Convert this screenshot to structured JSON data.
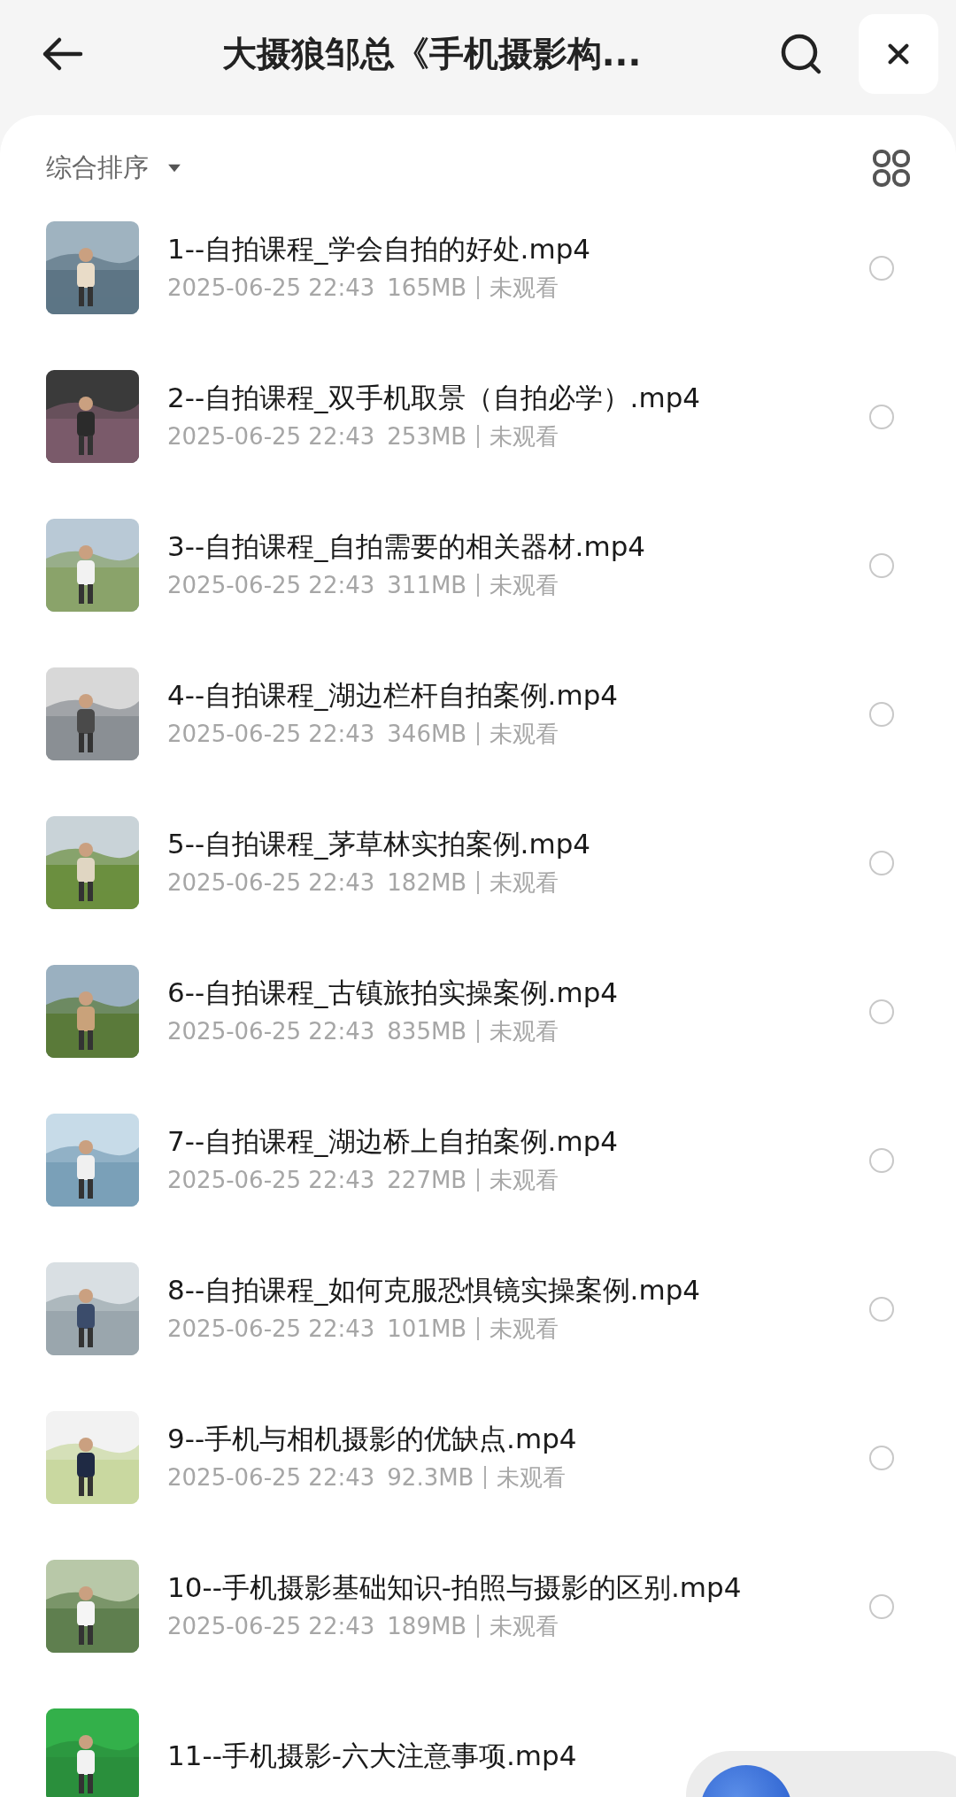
{
  "header": {
    "title": "大摄狼邹总《手机摄影构..."
  },
  "sort": {
    "label": "综合排序"
  },
  "files": [
    {
      "name": "1--自拍课程_学会自拍的好处.mp4",
      "date": "2025-06-25 22:43",
      "size": "165MB",
      "status": "未观看",
      "selected": false
    },
    {
      "name": "2--自拍课程_双手机取景（自拍必学）.mp4",
      "date": "2025-06-25 22:43",
      "size": "253MB",
      "status": "未观看",
      "selected": false
    },
    {
      "name": "3--自拍课程_自拍需要的相关器材.mp4",
      "date": "2025-06-25 22:43",
      "size": "311MB",
      "status": "未观看",
      "selected": false
    },
    {
      "name": "4--自拍课程_湖边栏杆自拍案例.mp4",
      "date": "2025-06-25 22:43",
      "size": "346MB",
      "status": "未观看",
      "selected": false
    },
    {
      "name": "5--自拍课程_茅草林实拍案例.mp4",
      "date": "2025-06-25 22:43",
      "size": "182MB",
      "status": "未观看",
      "selected": false
    },
    {
      "name": "6--自拍课程_古镇旅拍实操案例.mp4",
      "date": "2025-06-25 22:43",
      "size": "835MB",
      "status": "未观看",
      "selected": false
    },
    {
      "name": "7--自拍课程_湖边桥上自拍案例.mp4",
      "date": "2025-06-25 22:43",
      "size": "227MB",
      "status": "未观看",
      "selected": false
    },
    {
      "name": "8--自拍课程_如何克服恐惧镜实操案例.mp4",
      "date": "2025-06-25 22:43",
      "size": "101MB",
      "status": "未观看",
      "selected": false
    },
    {
      "name": "9--手机与相机摄影的优缺点.mp4",
      "date": "2025-06-25 22:43",
      "size": "92.3MB",
      "status": "未观看",
      "selected": false
    },
    {
      "name": "10--手机摄影基础知识-拍照与摄影的区别.mp4",
      "date": "2025-06-25 22:43",
      "size": "189MB",
      "status": "未观看",
      "selected": false
    },
    {
      "name": "11--手机摄影-六大注意事项.mp4"
    }
  ]
}
